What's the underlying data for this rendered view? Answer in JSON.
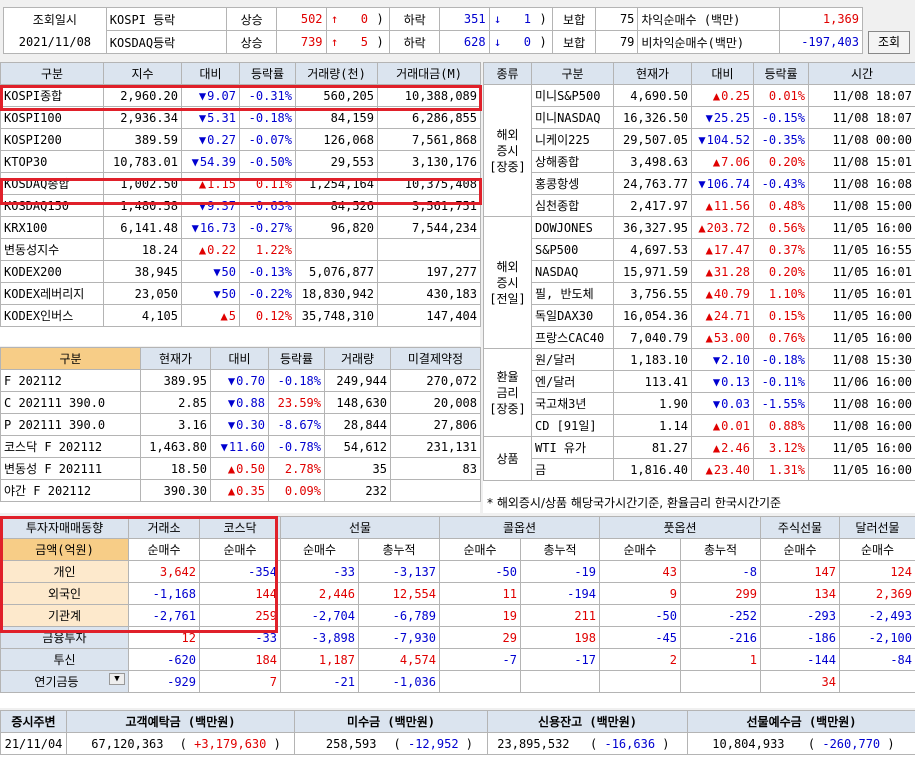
{
  "header": {
    "date_label": "조회일시",
    "date": "2021/11/08",
    "rows": [
      {
        "name": "KOSPI 등락",
        "up_label": "상승",
        "up": "502",
        "up_arrow": "↑",
        "up_chg": "0",
        "down_label": "하락",
        "down": "351",
        "down_arrow": "↓",
        "down_chg": "1",
        "flat_label": "보합",
        "flat": "75",
        "arb_label": "차익순매수 (백만)",
        "arb": "1,369"
      },
      {
        "name": "KOSDAQ등락",
        "up_label": "상승",
        "up": "739",
        "up_arrow": "↑",
        "up_chg": "5",
        "down_label": "하락",
        "down": "628",
        "down_arrow": "↓",
        "down_chg": "0",
        "flat_label": "보합",
        "flat": "79",
        "arb_label": "비차익순매수(백만)",
        "arb": "-197,403"
      }
    ],
    "search_button": "조회"
  },
  "index_table": {
    "headers": [
      "구분",
      "지수",
      "대비",
      "등락률",
      "거래량(천)",
      "거래대금(M)"
    ],
    "rows": [
      {
        "name": "KOSPI종합",
        "value": "2,960.20",
        "dir": "dn",
        "chg": "9.07",
        "rate": "-0.31%",
        "vol": "560,205",
        "amt": "10,388,089"
      },
      {
        "name": "KOSPI100",
        "value": "2,936.34",
        "dir": "dn",
        "chg": "5.31",
        "rate": "-0.18%",
        "vol": "84,159",
        "amt": "6,286,855"
      },
      {
        "name": "KOSPI200",
        "value": "389.59",
        "dir": "dn",
        "chg": "0.27",
        "rate": "-0.07%",
        "vol": "126,068",
        "amt": "7,561,868"
      },
      {
        "name": "KTOP30",
        "value": "10,783.01",
        "dir": "dn",
        "chg": "54.39",
        "rate": "-0.50%",
        "vol": "29,553",
        "amt": "3,130,176"
      },
      {
        "name": "KOSDAQ종합",
        "value": "1,002.50",
        "dir": "up",
        "chg": "1.15",
        "rate": "0.11%",
        "vol": "1,254,164",
        "amt": "10,375,408"
      },
      {
        "name": "KOSDAQ150",
        "value": "1,480.58",
        "dir": "dn",
        "chg": "9.37",
        "rate": "-0.63%",
        "vol": "84,526",
        "amt": "3,561,751"
      },
      {
        "name": "KRX100",
        "value": "6,141.48",
        "dir": "dn",
        "chg": "16.73",
        "rate": "-0.27%",
        "vol": "96,820",
        "amt": "7,544,234"
      },
      {
        "name": "변동성지수",
        "value": "18.24",
        "dir": "up",
        "chg": "0.22",
        "rate": "1.22%",
        "vol": "",
        "amt": ""
      },
      {
        "name": "KODEX200",
        "value": "38,945",
        "dir": "dn",
        "chg": "50",
        "rate": "-0.13%",
        "vol": "5,076,877",
        "amt": "197,277"
      },
      {
        "name": "KODEX레버리지",
        "value": "23,050",
        "dir": "dn",
        "chg": "50",
        "rate": "-0.22%",
        "vol": "18,830,942",
        "amt": "430,183"
      },
      {
        "name": "KODEX인버스",
        "value": "4,105",
        "dir": "up",
        "chg": "5",
        "rate": "0.12%",
        "vol": "35,748,310",
        "amt": "147,404"
      }
    ]
  },
  "futures_table": {
    "headers": [
      "구분",
      "현재가",
      "대비",
      "등락률",
      "거래량",
      "미결제약정"
    ],
    "rows": [
      {
        "name": "F 202112",
        "value": "389.95",
        "dir": "dn",
        "chg": "0.70",
        "rate": "-0.18%",
        "vol": "249,944",
        "oi": "270,072"
      },
      {
        "name": "C 202111 390.0",
        "value": "2.85",
        "dir": "dn",
        "chg": "0.88",
        "rate": "23.59%",
        "vol": "148,630",
        "oi": "20,008"
      },
      {
        "name": "P 202111 390.0",
        "value": "3.16",
        "dir": "dn",
        "chg": "0.30",
        "rate": "-8.67%",
        "vol": "28,844",
        "oi": "27,806"
      },
      {
        "name": "코스닥 F 202112",
        "value": "1,463.80",
        "dir": "dn",
        "chg": "11.60",
        "rate": "-0.78%",
        "vol": "54,612",
        "oi": "231,131"
      },
      {
        "name": "변동성 F 202111",
        "value": "18.50",
        "dir": "up",
        "chg": "0.50",
        "rate": "2.78%",
        "vol": "35",
        "oi": "83"
      },
      {
        "name": "야간 F 202112",
        "value": "390.30",
        "dir": "up",
        "chg": "0.35",
        "rate": "0.09%",
        "vol": "232",
        "oi": ""
      }
    ]
  },
  "world_table": {
    "headers": [
      "종류",
      "구분",
      "현재가",
      "대비",
      "등락률",
      "시간"
    ],
    "groups": [
      {
        "label": "해외\n증시\n[장중]",
        "rows": [
          {
            "name": "미니S&P500",
            "value": "4,690.50",
            "dir": "up",
            "chg": "0.25",
            "rate": "0.01%",
            "time": "11/08 18:07"
          },
          {
            "name": "미니NASDAQ",
            "value": "16,326.50",
            "dir": "dn",
            "chg": "25.25",
            "rate": "-0.15%",
            "time": "11/08 18:07"
          },
          {
            "name": "니케이225",
            "value": "29,507.05",
            "dir": "dn",
            "chg": "104.52",
            "rate": "-0.35%",
            "time": "11/08 00:00"
          },
          {
            "name": "상해종합",
            "value": "3,498.63",
            "dir": "up",
            "chg": "7.06",
            "rate": "0.20%",
            "time": "11/08 15:01"
          },
          {
            "name": "홍콩항셍",
            "value": "24,763.77",
            "dir": "dn",
            "chg": "106.74",
            "rate": "-0.43%",
            "time": "11/08 16:08"
          },
          {
            "name": "심천종합",
            "value": "2,417.97",
            "dir": "up",
            "chg": "11.56",
            "rate": "0.48%",
            "time": "11/08 15:00"
          }
        ]
      },
      {
        "label": "해외\n증시\n[전일]",
        "rows": [
          {
            "name": "DOWJONES",
            "value": "36,327.95",
            "dir": "up",
            "chg": "203.72",
            "rate": "0.56%",
            "time": "11/05 16:00"
          },
          {
            "name": "S&P500",
            "value": "4,697.53",
            "dir": "up",
            "chg": "17.47",
            "rate": "0.37%",
            "time": "11/05 16:55"
          },
          {
            "name": "NASDAQ",
            "value": "15,971.59",
            "dir": "up",
            "chg": "31.28",
            "rate": "0.20%",
            "time": "11/05 16:01"
          },
          {
            "name": "필, 반도체",
            "value": "3,756.55",
            "dir": "up",
            "chg": "40.79",
            "rate": "1.10%",
            "time": "11/05 16:01"
          },
          {
            "name": "독일DAX30",
            "value": "16,054.36",
            "dir": "up",
            "chg": "24.71",
            "rate": "0.15%",
            "time": "11/05 16:00"
          },
          {
            "name": "프랑스CAC40",
            "value": "7,040.79",
            "dir": "up",
            "chg": "53.00",
            "rate": "0.76%",
            "time": "11/05 16:00"
          }
        ]
      },
      {
        "label": "환율\n금리\n[장중]",
        "rows": [
          {
            "name": "원/달러",
            "value": "1,183.10",
            "dir": "dn",
            "chg": "2.10",
            "rate": "-0.18%",
            "time": "11/08 15:30"
          },
          {
            "name": "엔/달러",
            "value": "113.41",
            "dir": "dn",
            "chg": "0.13",
            "rate": "-0.11%",
            "time": "11/06 16:00"
          },
          {
            "name": "국고채3년",
            "value": "1.90",
            "dir": "dn",
            "chg": "0.03",
            "rate": "-1.55%",
            "time": "11/08 16:00"
          },
          {
            "name": "CD [91일]",
            "value": "1.14",
            "dir": "up",
            "chg": "0.01",
            "rate": "0.88%",
            "time": "11/08 16:00"
          }
        ]
      },
      {
        "label": "상품",
        "rows": [
          {
            "name": "WTI 유가",
            "value": "81.27",
            "dir": "up",
            "chg": "2.46",
            "rate": "3.12%",
            "time": "11/05 16:00"
          },
          {
            "name": "금",
            "value": "1,816.40",
            "dir": "up",
            "chg": "23.40",
            "rate": "1.31%",
            "time": "11/05 16:00"
          }
        ]
      }
    ],
    "footnote": "* 해외증시/상품 해당국가시간기준, 환율금리 한국시간기준"
  },
  "investor_table": {
    "top_headers": [
      "투자자매매동향",
      "거래소",
      "코스닥",
      "선물",
      "콜옵션",
      "풋옵션",
      "주식선물",
      "달러선물"
    ],
    "sub_headers": [
      "금액(억원)",
      "순매수",
      "순매수",
      "순매수",
      "총누적",
      "순매수",
      "총누적",
      "순매수",
      "총누적",
      "순매수",
      "순매수"
    ],
    "rows": [
      {
        "name": "개인",
        "vals": [
          "3,642",
          "-354",
          "-33",
          "-3,137",
          "-50",
          "-19",
          "43",
          "-8",
          "147",
          "124"
        ]
      },
      {
        "name": "외국인",
        "vals": [
          "-1,168",
          "144",
          "2,446",
          "12,554",
          "11",
          "-194",
          "9",
          "299",
          "134",
          "2,369"
        ]
      },
      {
        "name": "기관계",
        "vals": [
          "-2,761",
          "259",
          "-2,704",
          "-6,789",
          "19",
          "211",
          "-50",
          "-252",
          "-293",
          "-2,493"
        ]
      },
      {
        "name": "금융투자",
        "vals": [
          "12",
          "-33",
          "-3,898",
          "-7,930",
          "29",
          "198",
          "-45",
          "-216",
          "-186",
          "-2,100"
        ]
      },
      {
        "name": "투신",
        "vals": [
          "-620",
          "184",
          "1,187",
          "4,574",
          "-7",
          "-17",
          "2",
          "1",
          "-144",
          "-84"
        ]
      },
      {
        "name": "연기금등",
        "vals": [
          "-929",
          "7",
          "-21",
          "-1,036",
          "",
          "",
          "",
          "",
          "34",
          ""
        ]
      }
    ],
    "select_arrow": "▼"
  },
  "bottom": {
    "headers": [
      "증시주변",
      "고객예탁금 (백만원)",
      "미수금 (백만원)",
      "신용잔고 (백만원)",
      "선물예수금 (백만원)"
    ],
    "date": "21/11/04",
    "deposit": "67,120,363",
    "deposit_chg": "+3,179,630",
    "unpaid": "258,593",
    "unpaid_chg": "-12,952",
    "credit": "23,895,532",
    "credit_chg": "-16,636",
    "fut": "10,804,933",
    "fut_chg": "-260,770"
  }
}
